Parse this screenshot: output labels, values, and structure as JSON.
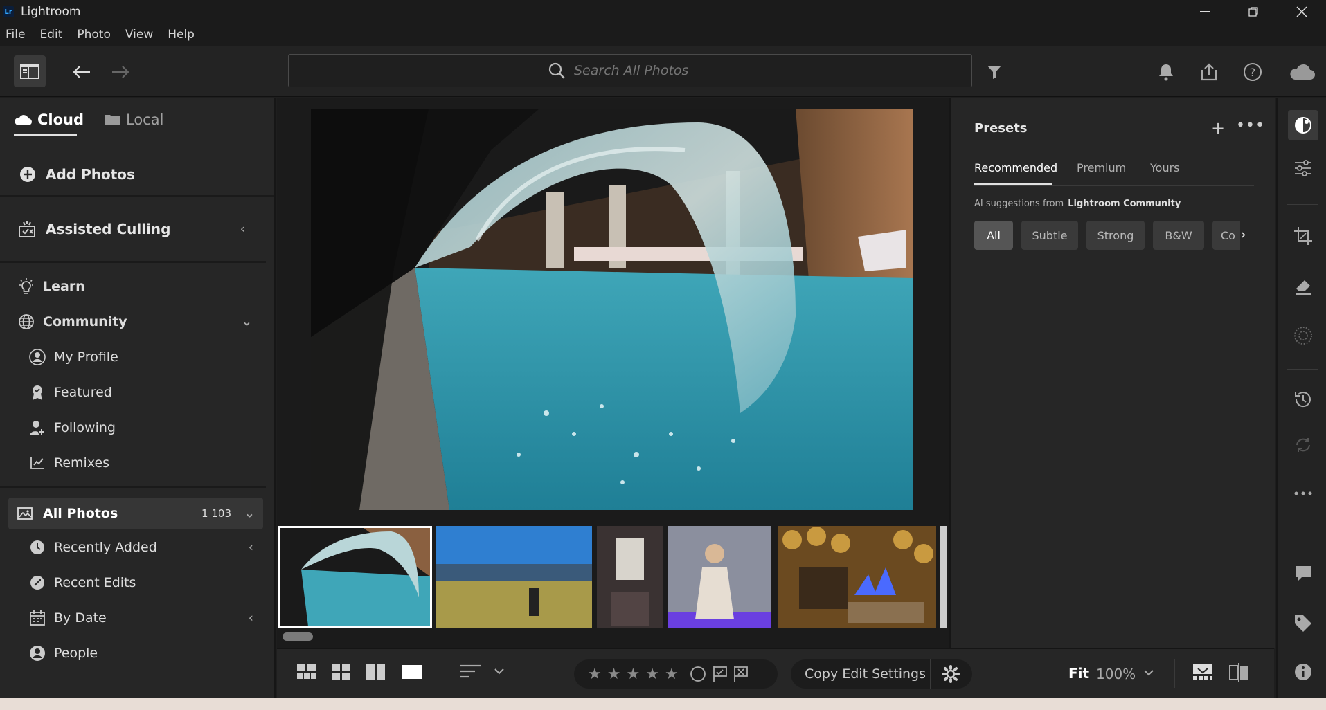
{
  "window": {
    "title": "Lightroom",
    "logo": "Lr"
  },
  "menu": [
    "File",
    "Edit",
    "Photo",
    "View",
    "Help"
  ],
  "toolbar": {
    "search_placeholder": "Search All Photos"
  },
  "sidebar": {
    "tabs": {
      "cloud": "Cloud",
      "local": "Local"
    },
    "add_photos": "Add Photos",
    "assisted_culling": "Assisted Culling",
    "learn": "Learn",
    "community": "Community",
    "community_items": [
      "My Profile",
      "Featured",
      "Following",
      "Remixes"
    ],
    "all_photos": "All Photos",
    "all_photos_count": "1 103",
    "library_items": [
      "Recently Added",
      "Recent Edits",
      "By Date",
      "People"
    ]
  },
  "presets": {
    "title": "Presets",
    "tabs": [
      "Recommended",
      "Premium",
      "Yours"
    ],
    "ai_prefix": "AI suggestions from",
    "ai_source": "Lightroom Community",
    "chips": [
      "All",
      "Subtle",
      "Strong",
      "B&W",
      "Co"
    ]
  },
  "bottombar": {
    "copy_edit": "Copy Edit Settings",
    "fit": "Fit",
    "zoom": "100%"
  },
  "colors": {
    "background": "#1e1e1e",
    "panel": "#262626",
    "accent_logo": "#31a8ff"
  }
}
